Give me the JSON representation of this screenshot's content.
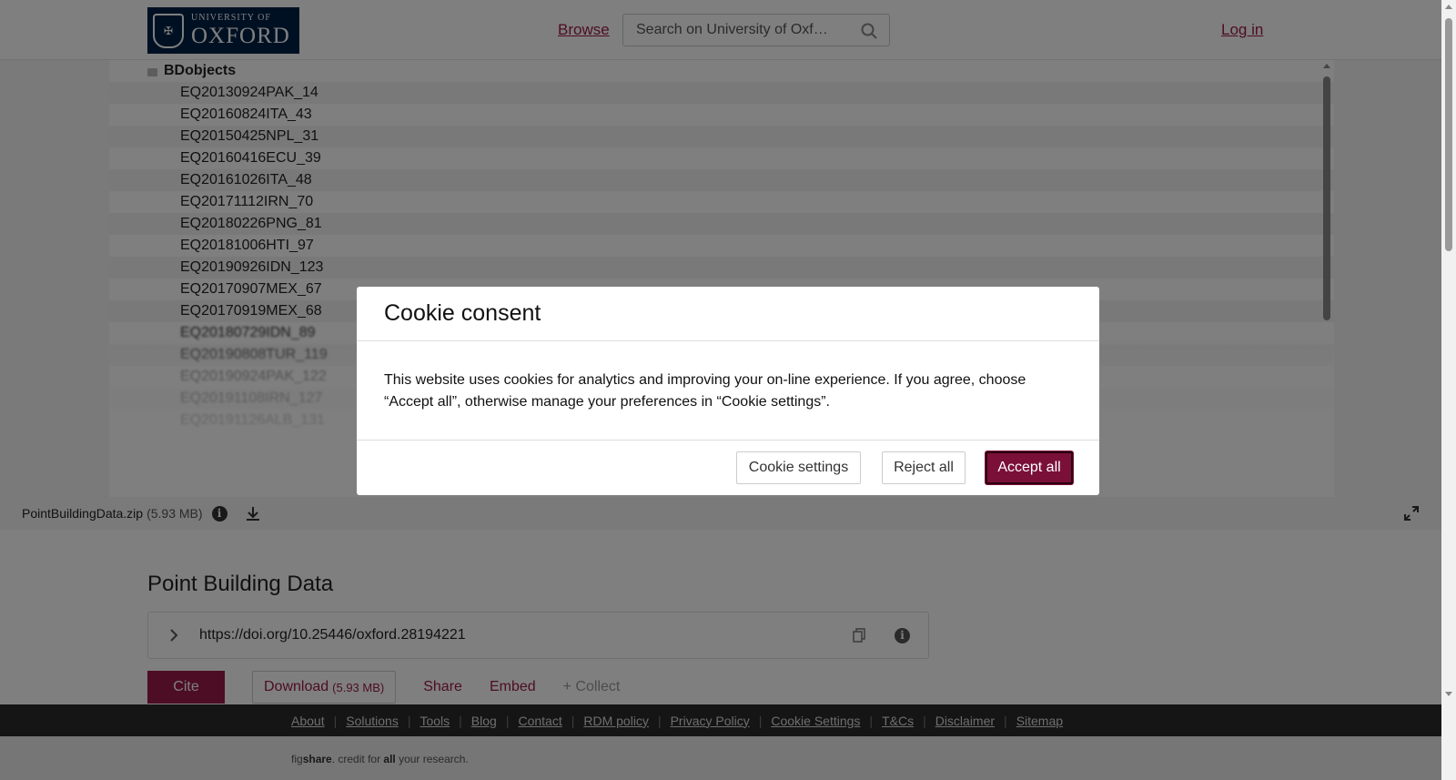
{
  "header": {
    "logo_small": "UNIVERSITY OF",
    "logo_big": "OXFORD",
    "browse": "Browse",
    "search_placeholder": "Search on University of Oxf…",
    "login": "Log in"
  },
  "viewer": {
    "folder": "BDobjects",
    "items": [
      "EQ20130924PAK_14",
      "EQ20160824ITA_43",
      "EQ20150425NPL_31",
      "EQ20160416ECU_39",
      "EQ20161026ITA_48",
      "EQ20171112IRN_70",
      "EQ20180226PNG_81",
      "EQ20181006HTI_97",
      "EQ20190926IDN_123",
      "EQ20170907MEX_67",
      "EQ20170919MEX_68",
      "EQ20180729IDN_89",
      "EQ20190808TUR_119",
      "EQ20190924PAK_122",
      "EQ20191108IRN_127",
      "EQ20191126ALB_131"
    ],
    "file_name": "PointBuildingData.zip",
    "file_size": "(5.93 MB)"
  },
  "content": {
    "title": "Point Building Data",
    "doi": "https://doi.org/10.25446/oxford.28194221",
    "cite": "Cite",
    "download": "Download",
    "download_size": "(5.93 MB)",
    "share": "Share",
    "embed": "Embed",
    "collect": "+ Collect"
  },
  "footer": {
    "links": [
      "About",
      "Solutions",
      "Tools",
      "Blog",
      "Contact",
      "RDM policy",
      "Privacy Policy",
      "Cookie Settings",
      "T&Cs",
      "Disclaimer",
      "Sitemap"
    ],
    "tag_pre": "fig",
    "tag_bold1": "share",
    "tag_mid": ". credit for ",
    "tag_bold2": "all",
    "tag_post": " your research."
  },
  "modal": {
    "title": "Cookie consent",
    "body": "This website uses cookies for analytics and improving your on-line experience. If you agree, choose “Accept all”, otherwise manage your preferences in “Cookie settings”.",
    "settings": "Cookie settings",
    "reject": "Reject all",
    "accept": "Accept all"
  },
  "colors": {
    "brand": "#9b1b48",
    "oxford_blue": "#002147",
    "accept": "#7a1038"
  }
}
